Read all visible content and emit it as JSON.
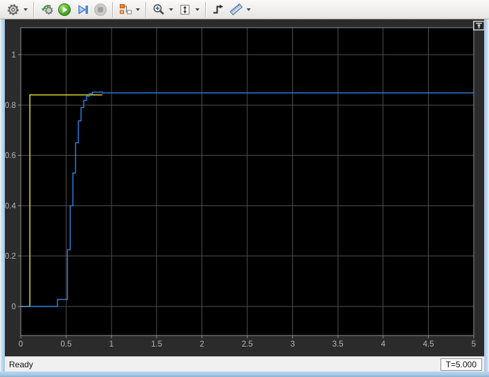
{
  "toolbar": {
    "buttons": [
      {
        "id": "parameters",
        "icon": "gear-icon",
        "dropdown": true,
        "disabled": false
      },
      {
        "id": "step-back",
        "icon": "step-back-icon",
        "dropdown": false,
        "disabled": false
      },
      {
        "id": "run",
        "icon": "run-icon",
        "dropdown": false,
        "disabled": false
      },
      {
        "id": "step-forward",
        "icon": "step-forward-icon",
        "dropdown": false,
        "disabled": false
      },
      {
        "id": "stop",
        "icon": "stop-icon",
        "dropdown": false,
        "disabled": true
      },
      {
        "id": "simulink-snapshot",
        "icon": "blocks-icon",
        "dropdown": true,
        "disabled": false
      },
      {
        "id": "zoom-in",
        "icon": "zoom-in-icon",
        "dropdown": true,
        "disabled": false
      },
      {
        "id": "scale-axes",
        "icon": "span-icon",
        "dropdown": true,
        "disabled": false
      },
      {
        "id": "triggers",
        "icon": "trigger-icon",
        "dropdown": false,
        "disabled": false
      },
      {
        "id": "measurements",
        "icon": "ruler-icon",
        "dropdown": true,
        "disabled": false
      }
    ]
  },
  "plot_panel": {
    "dock_icon": "dock-icon"
  },
  "chart_data": {
    "type": "line",
    "title": "",
    "xlabel": "",
    "ylabel": "",
    "xlim": [
      0,
      5
    ],
    "ylim": [
      -0.115,
      1.107
    ],
    "x_ticks": [
      0,
      0.5,
      1,
      1.5,
      2,
      2.5,
      3,
      3.5,
      4,
      4.5,
      5
    ],
    "x_tick_labels": [
      "0",
      "0.5",
      "1",
      "1.5",
      "2",
      "2.5",
      "3",
      "3.5",
      "4",
      "4.5",
      "5"
    ],
    "y_ticks": [
      0,
      0.2,
      0.4,
      0.6,
      0.8,
      1
    ],
    "y_tick_labels": [
      "0",
      "0.2",
      "0.4",
      "0.6",
      "0.8",
      "1"
    ],
    "grid": true,
    "legend": "none",
    "series": [
      {
        "name": "step-input",
        "color": "#f0e83a",
        "points": [
          [
            0,
            0
          ],
          [
            0.1,
            0
          ],
          [
            0.1,
            0.84
          ],
          [
            0.9,
            0.84
          ]
        ]
      },
      {
        "name": "staircase-response",
        "color": "#2d85e8",
        "points": [
          [
            0,
            0
          ],
          [
            0.405,
            0
          ],
          [
            0.405,
            0.028
          ],
          [
            0.515,
            0.028
          ],
          [
            0.515,
            0.225
          ],
          [
            0.545,
            0.225
          ],
          [
            0.545,
            0.4
          ],
          [
            0.575,
            0.4
          ],
          [
            0.575,
            0.53
          ],
          [
            0.605,
            0.53
          ],
          [
            0.605,
            0.65
          ],
          [
            0.635,
            0.65
          ],
          [
            0.635,
            0.737
          ],
          [
            0.665,
            0.737
          ],
          [
            0.665,
            0.79
          ],
          [
            0.695,
            0.79
          ],
          [
            0.695,
            0.818
          ],
          [
            0.725,
            0.818
          ],
          [
            0.725,
            0.835
          ],
          [
            0.755,
            0.835
          ],
          [
            0.755,
            0.845
          ],
          [
            0.79,
            0.845
          ],
          [
            0.79,
            0.851
          ],
          [
            0.9,
            0.851
          ],
          [
            0.9,
            0.848
          ],
          [
            5,
            0.848
          ]
        ]
      }
    ]
  },
  "colors": {
    "plot_background": "#000000",
    "grid_line": "#4f4f4f",
    "axis_border": "#8f8f8f",
    "tick_label": "#b8b8b8",
    "scope_background": "#2b2b2c",
    "window_frame": "#b9d3ea"
  },
  "statusbar": {
    "status_text": "Ready",
    "time_field": "T=5.000"
  }
}
